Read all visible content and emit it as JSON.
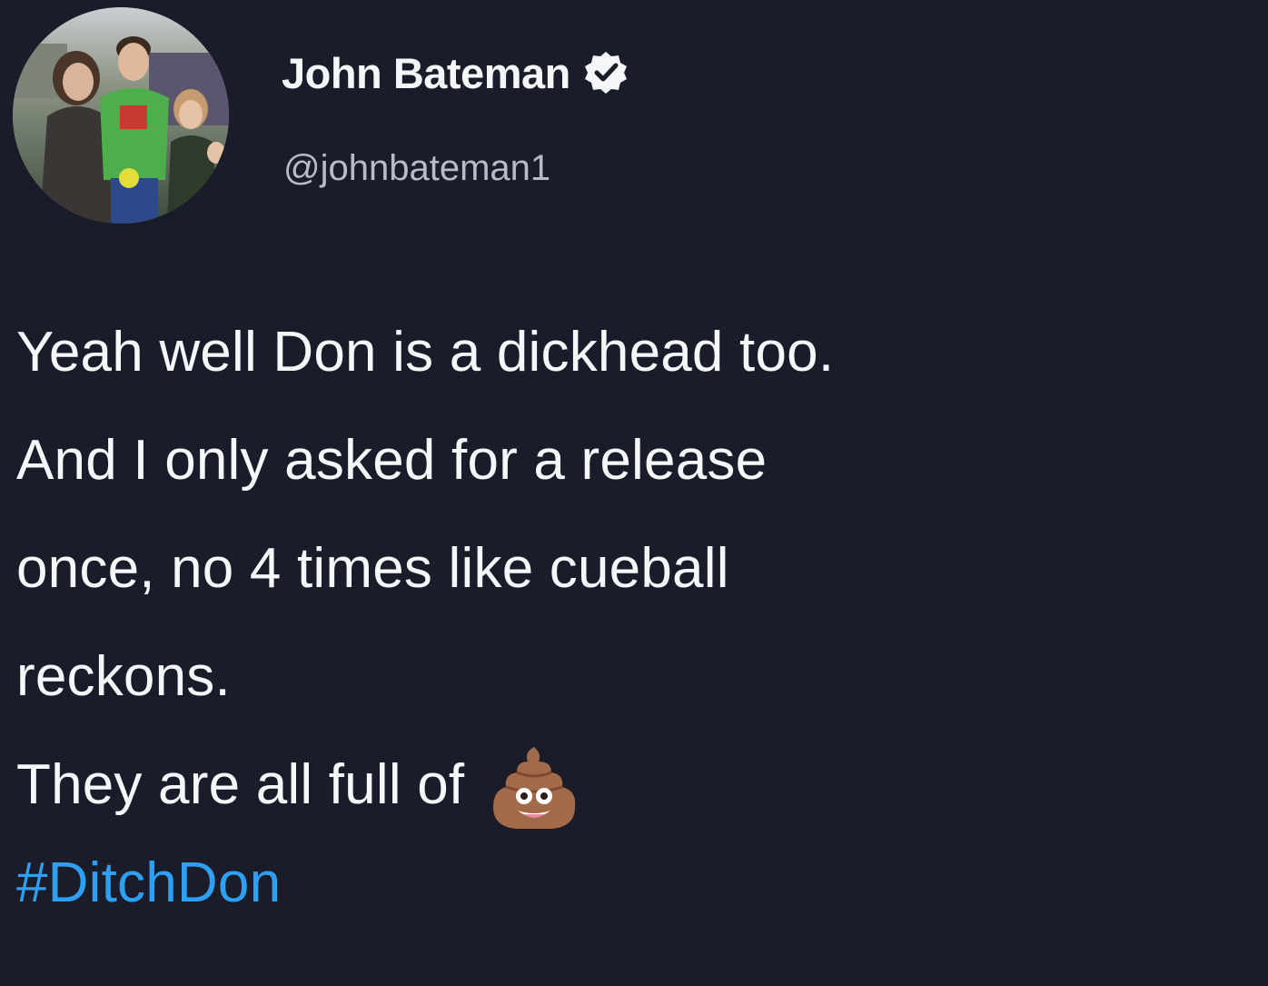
{
  "tweet": {
    "display_name": "John Bateman",
    "handle": "@johnbateman1",
    "body_lines": [
      "Yeah well Don is a dickhead too.",
      "And I only asked for a release",
      "once, no 4 times like cueball",
      "reckons.",
      "They are all full of"
    ],
    "emoji": "pile-of-poo-icon",
    "hashtag": "#DitchDon"
  },
  "colors": {
    "background": "#1a1d29",
    "text": "#f5f7f9",
    "handle": "#b7bdc5",
    "link": "#2e9ff1"
  }
}
